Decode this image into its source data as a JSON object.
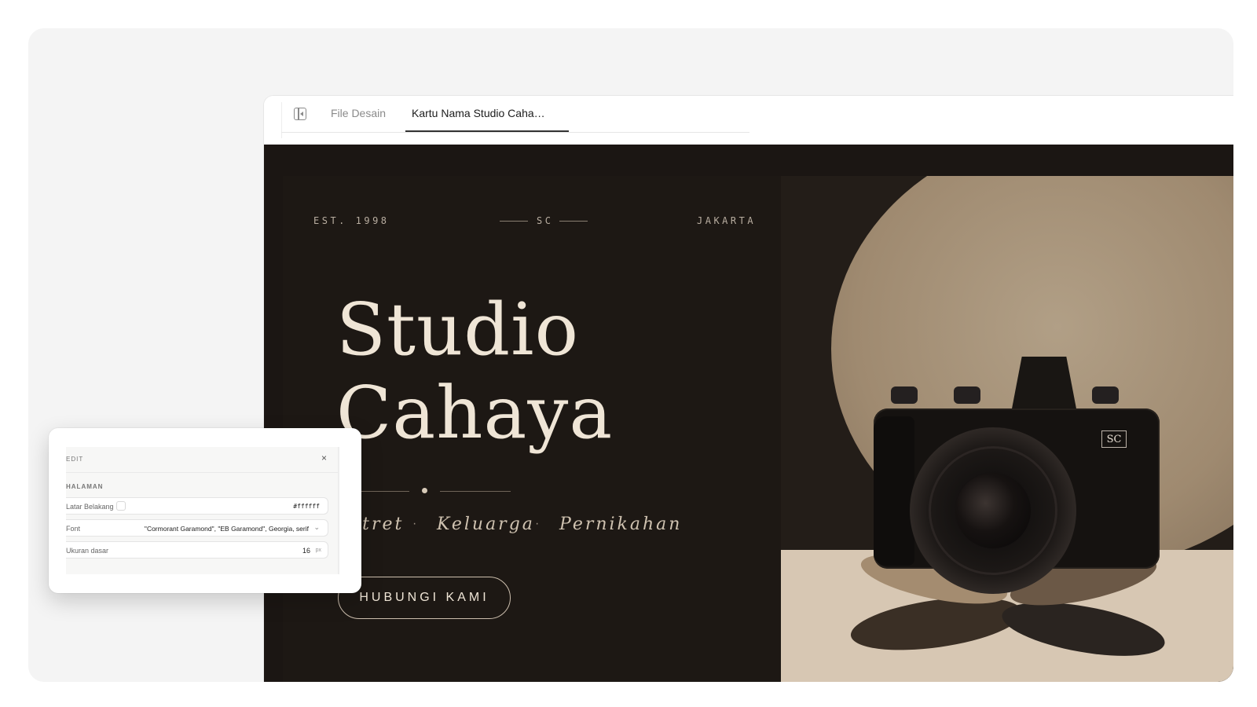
{
  "tabs": {
    "file_tab": "File Desain",
    "active_tab": "Kartu Nama Studio Caha…"
  },
  "card": {
    "meta_left": "EST. 1998",
    "meta_center": "SC",
    "meta_right": "JAKARTA",
    "title_line1": "Studio",
    "title_line2": "Cahaya",
    "service_1": "Potret",
    "service_2": "Keluarga",
    "service_3": "Pernikahan",
    "separator": "·",
    "cta_label": "HUBUNGI KAMI",
    "camera_logo": "SC"
  },
  "edit_panel": {
    "title": "EDIT",
    "close_glyph": "×",
    "section_label": "HALAMAN",
    "bg_label": "Latar Belakang",
    "bg_value": "#ffffff",
    "font_label": "Font",
    "font_value": "\"Cormorant Garamond\", \"EB Garamond\", Georgia, serif",
    "size_label": "Ukuran dasar",
    "size_value": "16",
    "size_unit": "px"
  },
  "colors": {
    "canvas_bg": "#1b1613",
    "title_cream": "#efe5d6",
    "photo_sun": "#b19f86",
    "floor": "#d7c7b3"
  }
}
